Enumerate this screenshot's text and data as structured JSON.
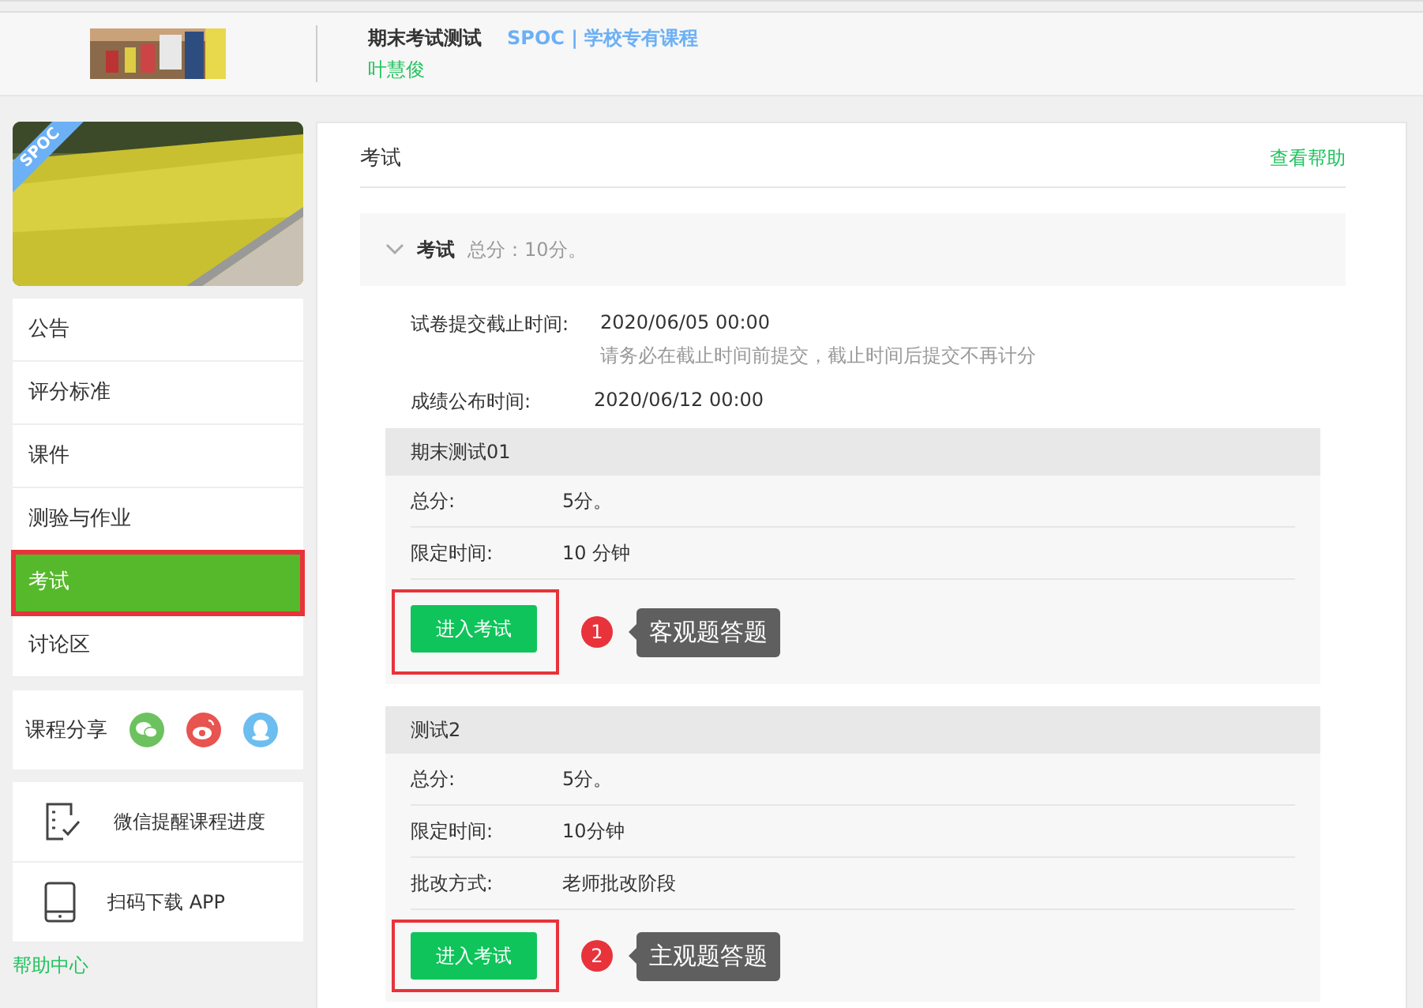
{
  "header": {
    "course_title": "期末考试测试",
    "course_type": "SPOC | 学校专有课程",
    "teacher": "叶慧俊"
  },
  "sidebar": {
    "badge": "SPOC",
    "items": [
      {
        "label": "公告",
        "selected": false,
        "highlighted": false
      },
      {
        "label": "评分标准",
        "selected": false,
        "highlighted": false
      },
      {
        "label": "课件",
        "selected": false,
        "highlighted": false
      },
      {
        "label": "测验与作业",
        "selected": false,
        "highlighted": false
      },
      {
        "label": "考试",
        "selected": true,
        "highlighted": true
      },
      {
        "label": "讨论区",
        "selected": false,
        "highlighted": false
      }
    ],
    "share_label": "课程分享",
    "tools": [
      {
        "kind": "checklist",
        "label": "微信提醒课程进度"
      },
      {
        "kind": "phone",
        "label": "扫码下载 APP"
      }
    ],
    "help_link": "帮助中心"
  },
  "main": {
    "title": "考试",
    "help_link": "查看帮助",
    "section": {
      "title": "考试",
      "score": "总分：10分。",
      "expanded": true
    },
    "deadline_label": "试卷提交截止时间:",
    "deadline": "2020/06/05 00:00",
    "deadline_note": "请务必在截止时间前提交，截止时间后提交不再计分",
    "publish_label": "成绩公布时间:",
    "publish": "2020/06/12 00:00",
    "exams": [
      {
        "title": "期末测试01",
        "rows": [
          {
            "label": "总分:",
            "value": "5分。"
          },
          {
            "label": "限定时间:",
            "value": "10 分钟"
          }
        ],
        "button": "进入考试",
        "annotation": {
          "number": "1",
          "text": "客观题答题"
        }
      },
      {
        "title": "测试2",
        "rows": [
          {
            "label": "总分:",
            "value": "5分。"
          },
          {
            "label": "限定时间:",
            "value": "10分钟"
          },
          {
            "label": "批改方式:",
            "value": "老师批改阶段"
          }
        ],
        "button": "进入考试",
        "annotation": {
          "number": "2",
          "text": "主观题答题"
        }
      }
    ]
  }
}
